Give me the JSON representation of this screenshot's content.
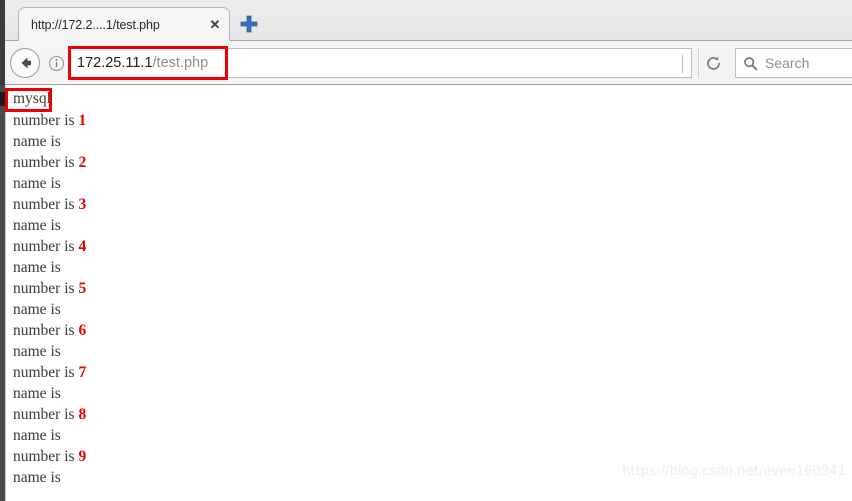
{
  "browser": {
    "tab": {
      "title": "http://172.2....1/test.php",
      "close_label": "✕"
    },
    "new_tab_label": "+",
    "toolbar": {
      "back_icon": "back-arrow-icon",
      "identity_icon": "info-icon",
      "reload_icon": "reload-icon",
      "url_host": "172.25.11.1",
      "url_path": "/test.php",
      "url_full": "172.25.11.1/test.php",
      "search_placeholder": "Search",
      "search_icon": "search-icon"
    },
    "annotations": {
      "url_box_color": "#ee0000",
      "mysql_box_color": "#ee0000"
    }
  },
  "page": {
    "heading": "mysql",
    "lines": [
      {
        "label": "number is",
        "value": "1"
      },
      {
        "label": "name is",
        "value": ""
      },
      {
        "label": "number is",
        "value": "2"
      },
      {
        "label": "name is",
        "value": ""
      },
      {
        "label": "number is",
        "value": "3"
      },
      {
        "label": "name is",
        "value": ""
      },
      {
        "label": "number is",
        "value": "4"
      },
      {
        "label": "name is",
        "value": ""
      },
      {
        "label": "number is",
        "value": "5"
      },
      {
        "label": "name is",
        "value": ""
      },
      {
        "label": "number is",
        "value": "6"
      },
      {
        "label": "name is",
        "value": ""
      },
      {
        "label": "number is",
        "value": "7"
      },
      {
        "label": "name is",
        "value": ""
      },
      {
        "label": "number is",
        "value": "8"
      },
      {
        "label": "name is",
        "value": ""
      },
      {
        "label": "number is",
        "value": "9"
      },
      {
        "label": "name is",
        "value": ""
      }
    ]
  },
  "watermark": "https://blog.csdn.net/even160941"
}
